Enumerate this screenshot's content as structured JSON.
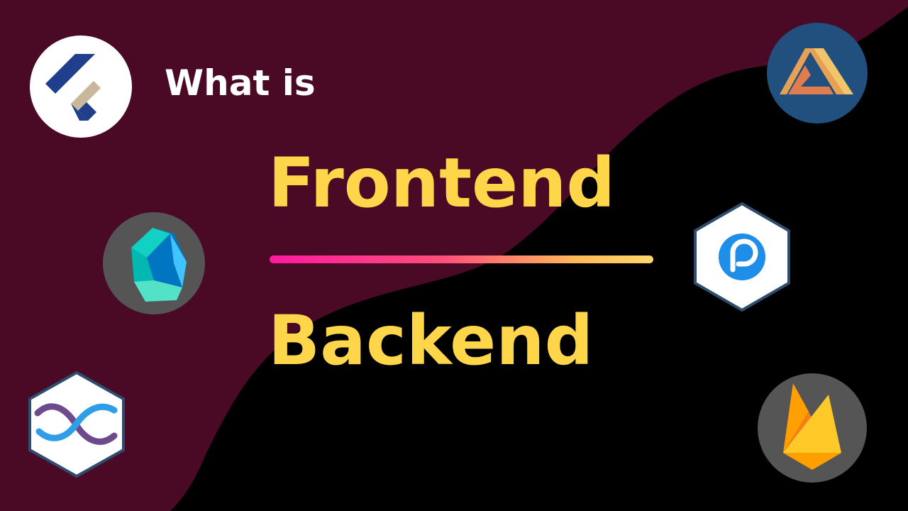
{
  "headline": {
    "line1": "What is",
    "line2": "Frontend",
    "line3": "Backend"
  },
  "colors": {
    "background_dark": "#000000",
    "background_maroon": "#4a0a26",
    "headline_white": "#ffffff",
    "headline_yellow": "#ffd54a",
    "divider_start": "#ff1a9f",
    "divider_end": "#ffd86a"
  },
  "logos": [
    {
      "name": "flutter-logo-icon"
    },
    {
      "name": "dart-logo-icon"
    },
    {
      "name": "tailwind-hex-logo-icon"
    },
    {
      "name": "amplify-logo-icon"
    },
    {
      "name": "parse-logo-icon"
    },
    {
      "name": "firebase-logo-icon"
    }
  ]
}
